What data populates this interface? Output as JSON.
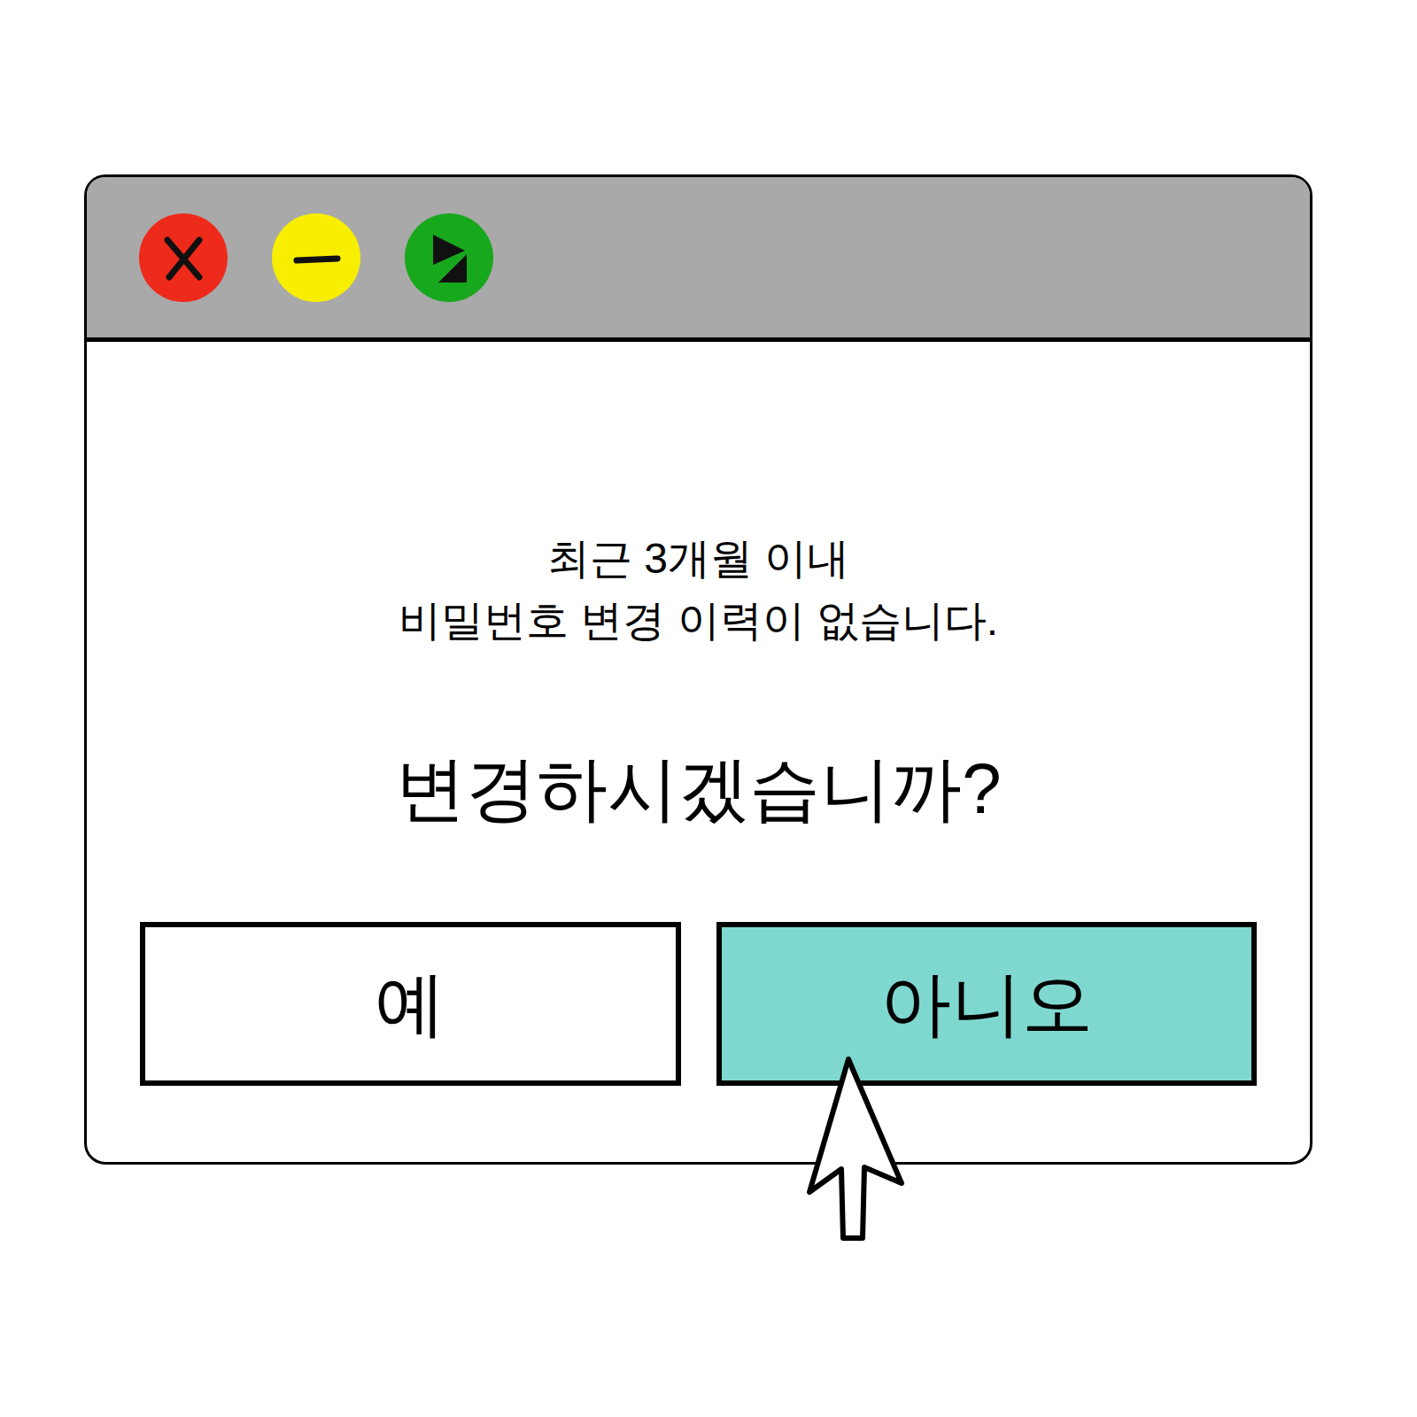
{
  "window": {
    "controls": [
      {
        "kind": "close",
        "color": "#ee2a1b"
      },
      {
        "kind": "minimize",
        "color": "#f8ee00"
      },
      {
        "kind": "maximize",
        "color": "#18a81e"
      }
    ]
  },
  "message": {
    "lines": [
      "최근 3개월 이내",
      "비밀번호 변경 이력이 없습니다."
    ]
  },
  "question": "변경하시겠습니까?",
  "buttons": [
    {
      "label": "예",
      "selected": false
    },
    {
      "label": "아니오",
      "selected": true
    }
  ]
}
